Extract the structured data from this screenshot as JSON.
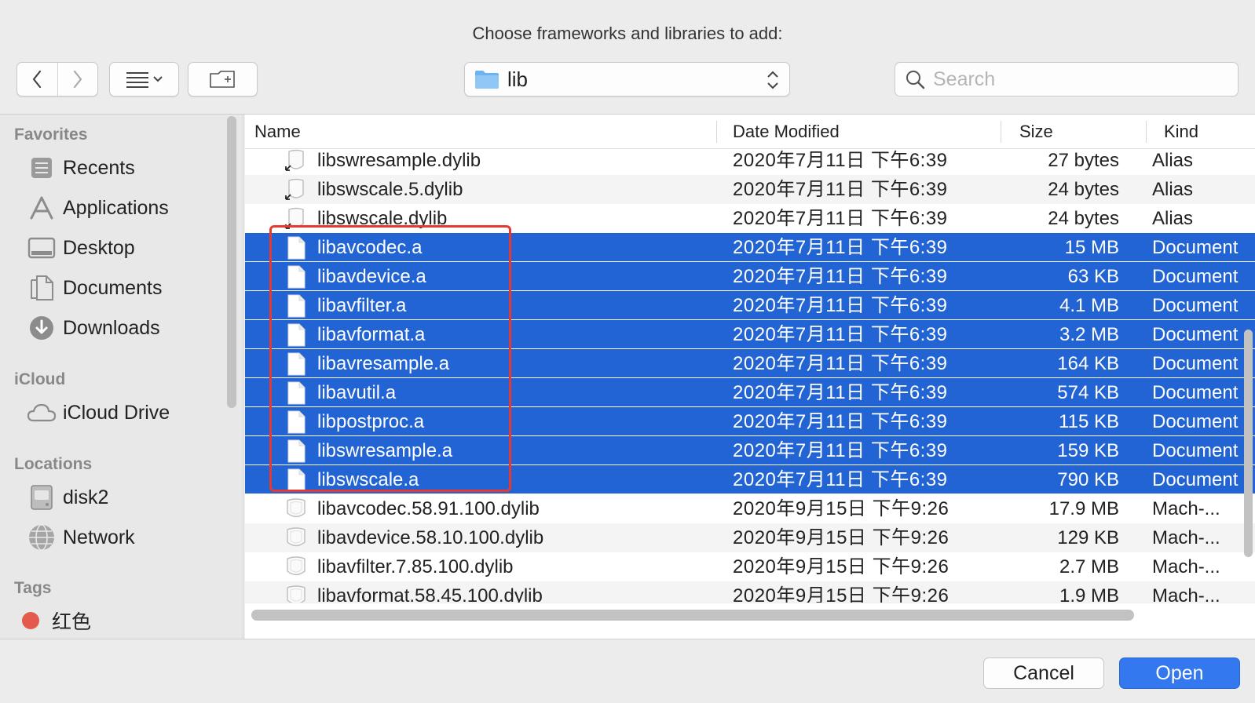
{
  "window": {
    "title": "Choose frameworks and libraries to add:"
  },
  "toolbar": {
    "back_icon": "chevron-left-icon",
    "forward_icon": "chevron-right-icon",
    "view_icon": "list-view-icon",
    "new_folder_icon": "new-folder-icon",
    "location": "lib",
    "search_placeholder": "Search"
  },
  "sidebar": {
    "favorites_heading": "Favorites",
    "favorites": [
      {
        "label": "Recents",
        "icon": "recents-icon"
      },
      {
        "label": "Applications",
        "icon": "applications-icon"
      },
      {
        "label": "Desktop",
        "icon": "desktop-icon"
      },
      {
        "label": "Documents",
        "icon": "documents-icon"
      },
      {
        "label": "Downloads",
        "icon": "downloads-icon"
      }
    ],
    "icloud_heading": "iCloud",
    "icloud": [
      {
        "label": "iCloud Drive",
        "icon": "cloud-icon"
      }
    ],
    "locations_heading": "Locations",
    "locations": [
      {
        "label": "disk2",
        "icon": "disk-icon"
      },
      {
        "label": "Network",
        "icon": "network-icon"
      }
    ],
    "tags_heading": "Tags",
    "tags": [
      {
        "label": "红色",
        "color": "#e45a4c"
      }
    ]
  },
  "columns": {
    "name": "Name",
    "date": "Date Modified",
    "size": "Size",
    "kind": "Kind"
  },
  "files": [
    {
      "name": "libswresample.dylib",
      "date": "2020年7月11日 下午6:39",
      "size": "27 bytes",
      "kind": "Alias",
      "type": "alias",
      "selected": false
    },
    {
      "name": "libswscale.5.dylib",
      "date": "2020年7月11日 下午6:39",
      "size": "24 bytes",
      "kind": "Alias",
      "type": "alias",
      "selected": false
    },
    {
      "name": "libswscale.dylib",
      "date": "2020年7月11日 下午6:39",
      "size": "24 bytes",
      "kind": "Alias",
      "type": "alias",
      "selected": false
    },
    {
      "name": "libavcodec.a",
      "date": "2020年7月11日 下午6:39",
      "size": "15 MB",
      "kind": "Document",
      "type": "doc",
      "selected": true
    },
    {
      "name": "libavdevice.a",
      "date": "2020年7月11日 下午6:39",
      "size": "63 KB",
      "kind": "Document",
      "type": "doc",
      "selected": true
    },
    {
      "name": "libavfilter.a",
      "date": "2020年7月11日 下午6:39",
      "size": "4.1 MB",
      "kind": "Document",
      "type": "doc",
      "selected": true
    },
    {
      "name": "libavformat.a",
      "date": "2020年7月11日 下午6:39",
      "size": "3.2 MB",
      "kind": "Document",
      "type": "doc",
      "selected": true
    },
    {
      "name": "libavresample.a",
      "date": "2020年7月11日 下午6:39",
      "size": "164 KB",
      "kind": "Document",
      "type": "doc",
      "selected": true
    },
    {
      "name": "libavutil.a",
      "date": "2020年7月11日 下午6:39",
      "size": "574 KB",
      "kind": "Document",
      "type": "doc",
      "selected": true
    },
    {
      "name": "libpostproc.a",
      "date": "2020年7月11日 下午6:39",
      "size": "115 KB",
      "kind": "Document",
      "type": "doc",
      "selected": true
    },
    {
      "name": "libswresample.a",
      "date": "2020年7月11日 下午6:39",
      "size": "159 KB",
      "kind": "Document",
      "type": "doc",
      "selected": true
    },
    {
      "name": "libswscale.a",
      "date": "2020年7月11日 下午6:39",
      "size": "790 KB",
      "kind": "Document",
      "type": "doc",
      "selected": true
    },
    {
      "name": "libavcodec.58.91.100.dylib",
      "date": "2020年9月15日 下午9:26",
      "size": "17.9 MB",
      "kind": "Mach-...",
      "type": "exec",
      "selected": false
    },
    {
      "name": "libavdevice.58.10.100.dylib",
      "date": "2020年9月15日 下午9:26",
      "size": "129 KB",
      "kind": "Mach-...",
      "type": "exec",
      "selected": false
    },
    {
      "name": "libavfilter.7.85.100.dylib",
      "date": "2020年9月15日 下午9:26",
      "size": "2.7 MB",
      "kind": "Mach-...",
      "type": "exec",
      "selected": false
    },
    {
      "name": "libavformat.58.45.100.dylib",
      "date": "2020年9月15日 下午9:26",
      "size": "1.9 MB",
      "kind": "Mach-...",
      "type": "exec",
      "selected": false
    }
  ],
  "footer": {
    "cancel_label": "Cancel",
    "open_label": "Open"
  },
  "colors": {
    "selection": "#2264d4",
    "annotation": "#e8392f",
    "primary_button": "#3478f0"
  }
}
